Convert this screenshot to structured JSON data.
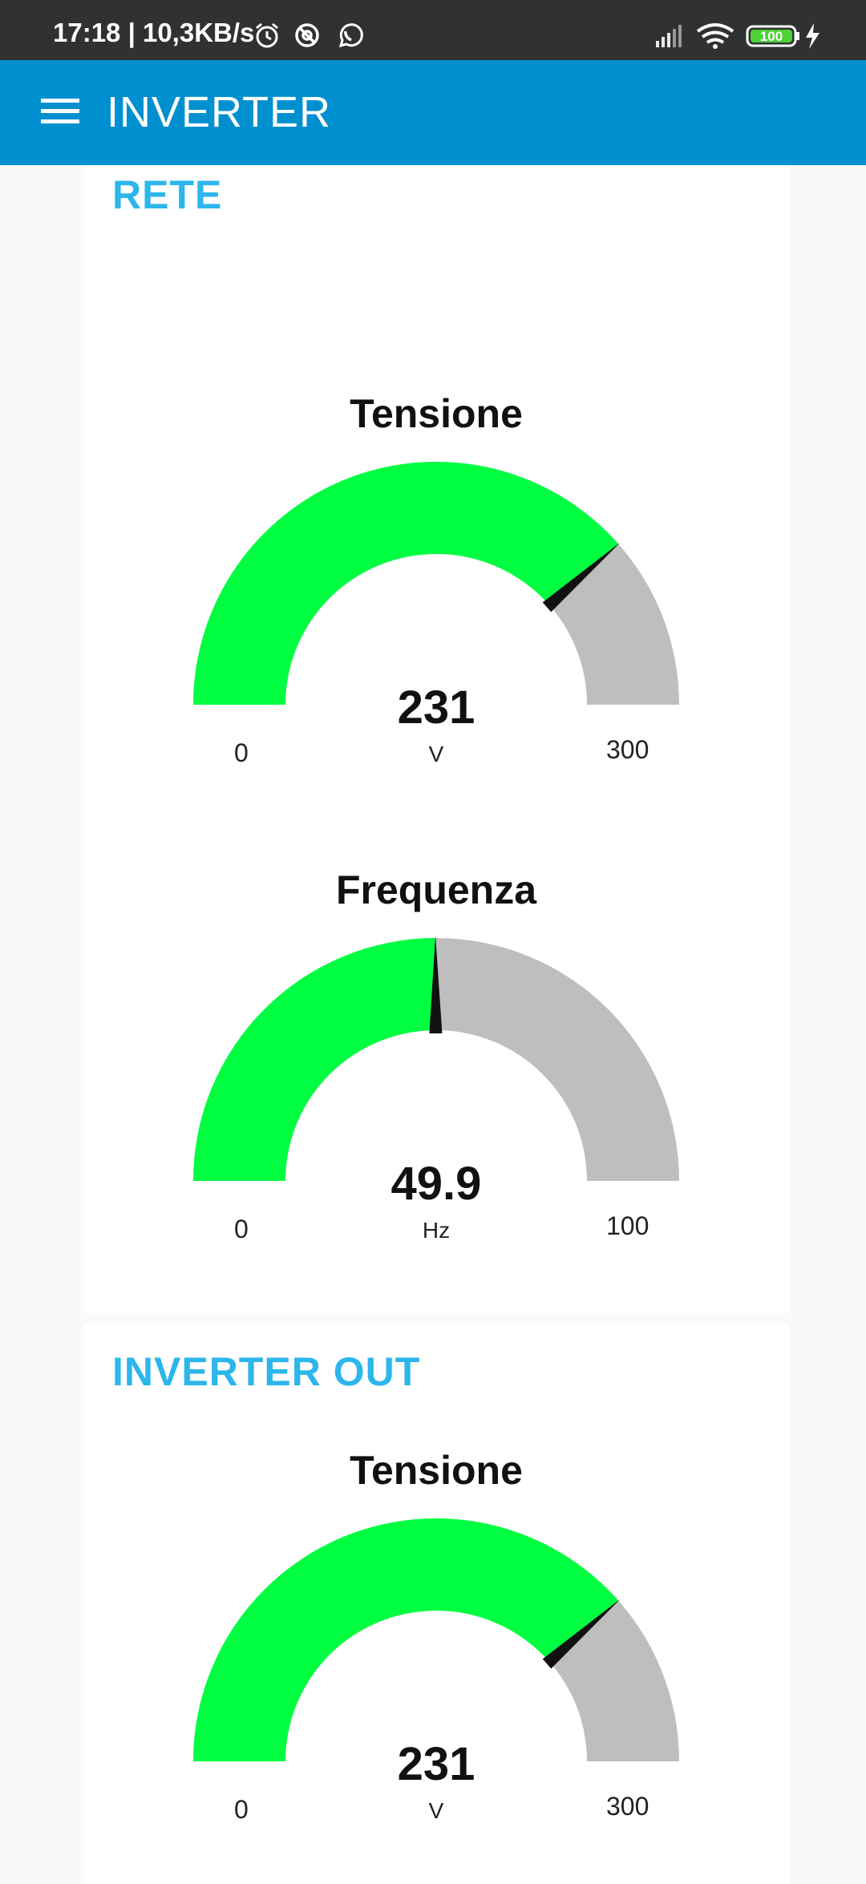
{
  "status_bar": {
    "time_speed": "17:18 | 10,3KB/s",
    "battery": "100",
    "icons": [
      "alarm-icon",
      "no-disturb-icon",
      "whatsapp-icon",
      "signal-icon",
      "wifi-icon",
      "battery-icon",
      "charging-icon"
    ]
  },
  "app_bar": {
    "title": "INVERTER",
    "menu_icon": "hamburger-menu-icon"
  },
  "groups": [
    {
      "title": "RETE",
      "gauges": [
        {
          "title": "Tensione",
          "value": "231",
          "unit": "V",
          "min": "0",
          "max": "300",
          "level": 0.77
        },
        {
          "title": "Frequenza",
          "value": "49.9",
          "unit": "Hz",
          "min": "0",
          "max": "100",
          "level": 0.499
        }
      ]
    },
    {
      "title": "INVERTER OUT",
      "gauges": [
        {
          "title": "Tensione",
          "value": "231",
          "unit": "V",
          "min": "0",
          "max": "300",
          "level": 0.77
        }
      ]
    }
  ],
  "colors": {
    "app_bar": "#0090cf",
    "group_title": "#2cb6ec",
    "gauge_fill": "#00ff41",
    "gauge_track": "#bebebe",
    "needle": "#111111"
  }
}
